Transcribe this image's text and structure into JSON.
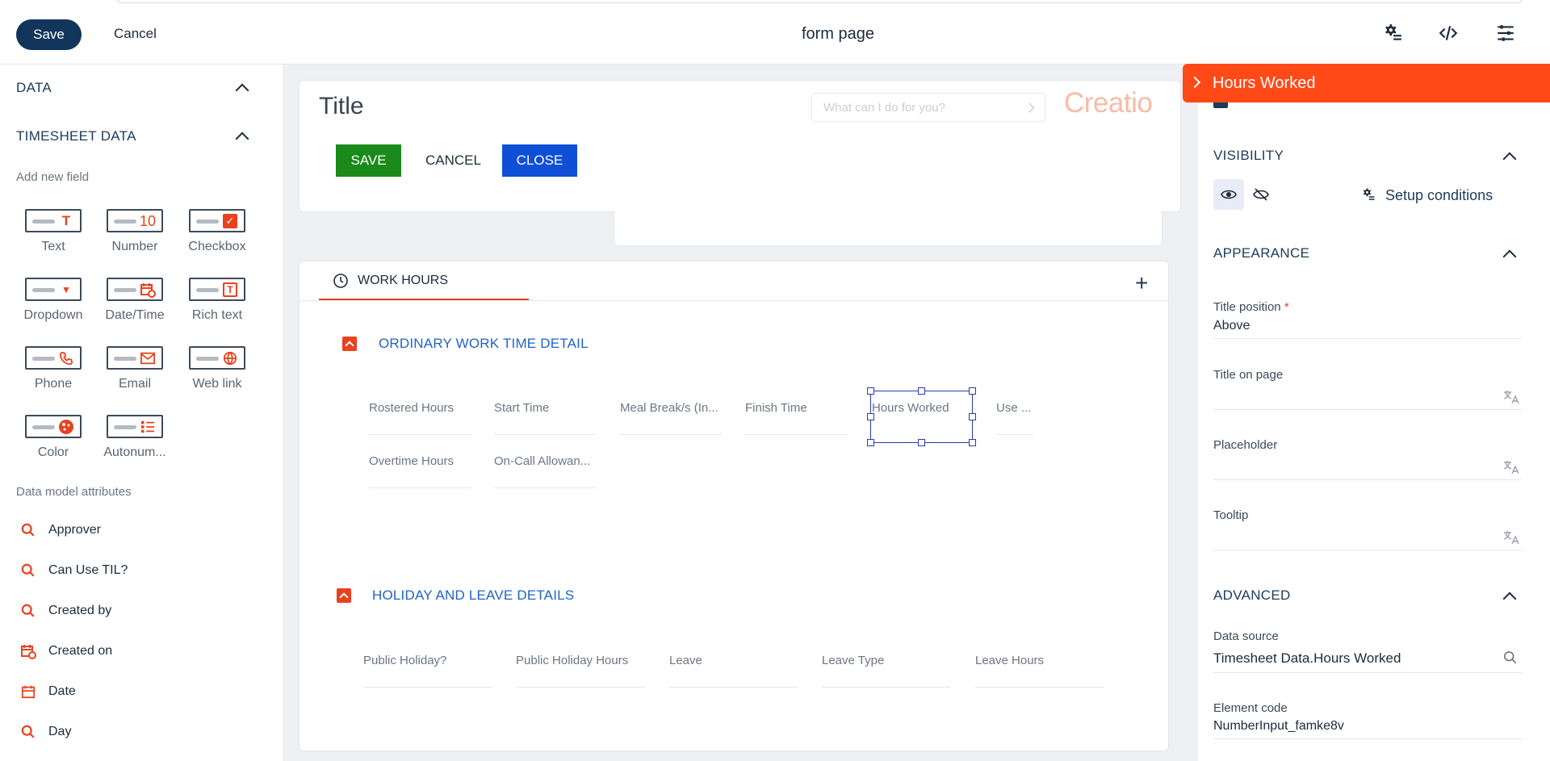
{
  "toolbar": {
    "save_label": "Save",
    "cancel_label": "Cancel",
    "title": "form page"
  },
  "left_panel": {
    "data_section": "DATA",
    "timesheet_section": "TIMESHEET DATA",
    "add_new_field": "Add new field",
    "field_types": [
      {
        "label": "Text",
        "icon": "text-field-icon",
        "glyph": "T"
      },
      {
        "label": "Number",
        "icon": "number-field-icon",
        "glyph": "10"
      },
      {
        "label": "Checkbox",
        "icon": "checkbox-field-icon",
        "glyph": "✓"
      },
      {
        "label": "Dropdown",
        "icon": "dropdown-field-icon",
        "glyph": "▼"
      },
      {
        "label": "Date/Time",
        "icon": "datetime-field-icon",
        "glyph": ""
      },
      {
        "label": "Rich text",
        "icon": "rich-text-field-icon",
        "glyph": "T"
      },
      {
        "label": "Phone",
        "icon": "phone-field-icon",
        "glyph": ""
      },
      {
        "label": "Email",
        "icon": "email-field-icon",
        "glyph": ""
      },
      {
        "label": "Web link",
        "icon": "web-link-field-icon",
        "glyph": ""
      },
      {
        "label": "Color",
        "icon": "color-field-icon",
        "glyph": ""
      },
      {
        "label": "Autonum...",
        "icon": "autonumber-field-icon",
        "glyph": ""
      }
    ],
    "data_model_attributes": "Data model attributes",
    "attributes": [
      {
        "label": "Approver",
        "icon": "lookup-icon"
      },
      {
        "label": "Can Use TIL?",
        "icon": "lookup-icon"
      },
      {
        "label": "Created by",
        "icon": "lookup-icon"
      },
      {
        "label": "Created on",
        "icon": "datetime-icon"
      },
      {
        "label": "Date",
        "icon": "calendar-icon"
      },
      {
        "label": "Day",
        "icon": "lookup-icon"
      }
    ]
  },
  "canvas": {
    "title": "Title",
    "search_placeholder": "What can I do for you?",
    "logo": "Creatio",
    "save_label": "SAVE",
    "cancel_label": "CANCEL",
    "close_label": "CLOSE",
    "tab_label": "WORK HOURS",
    "groups": [
      {
        "title": "ORDINARY WORK TIME DETAIL",
        "fields": [
          "Rostered Hours",
          "Start Time",
          "Meal Break/s (In...",
          "Finish Time",
          "Hours Worked",
          "Use ...",
          "Overtime Hours",
          "On-Call Allowan..."
        ]
      },
      {
        "title": "HOLIDAY AND LEAVE DETAILS",
        "fields": [
          "Public Holiday?",
          "Public Holiday Hours",
          "Leave",
          "Leave Type",
          "Leave Hours"
        ]
      }
    ]
  },
  "right_panel": {
    "element_title": "Hours Worked",
    "visibility_section": "VISIBILITY",
    "setup_conditions": "Setup conditions",
    "appearance_section": "APPEARANCE",
    "title_position_label": "Title position",
    "title_position_value": "Above",
    "required_mark": "*",
    "title_on_page_label": "Title on page",
    "placeholder_label": "Placeholder",
    "tooltip_label": "Tooltip",
    "advanced_section": "ADVANCED",
    "data_source_label": "Data source",
    "data_source_value": "Timesheet Data.Hours Worked",
    "element_code_label": "Element code",
    "element_code_value": "NumberInput_famke8v"
  },
  "colors": {
    "primary": "#12355b",
    "accent": "#ff4a17",
    "green": "#1a8a1a",
    "blue": "#0e4fd6",
    "link": "#1f63c6"
  }
}
